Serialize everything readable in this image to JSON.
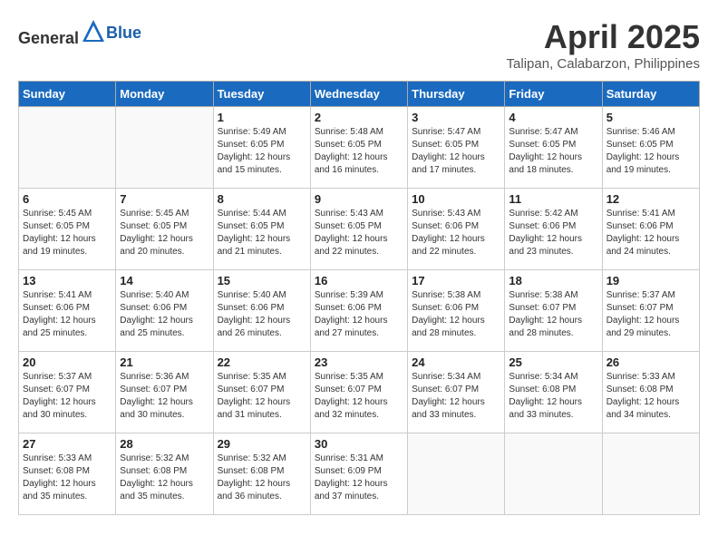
{
  "header": {
    "logo": {
      "text_general": "General",
      "text_blue": "Blue"
    },
    "title": "April 2025",
    "subtitle": "Talipan, Calabarzon, Philippines"
  },
  "calendar": {
    "days_of_week": [
      "Sunday",
      "Monday",
      "Tuesday",
      "Wednesday",
      "Thursday",
      "Friday",
      "Saturday"
    ],
    "weeks": [
      [
        {
          "day": "",
          "info": ""
        },
        {
          "day": "",
          "info": ""
        },
        {
          "day": "1",
          "info": "Sunrise: 5:49 AM\nSunset: 6:05 PM\nDaylight: 12 hours and 15 minutes."
        },
        {
          "day": "2",
          "info": "Sunrise: 5:48 AM\nSunset: 6:05 PM\nDaylight: 12 hours and 16 minutes."
        },
        {
          "day": "3",
          "info": "Sunrise: 5:47 AM\nSunset: 6:05 PM\nDaylight: 12 hours and 17 minutes."
        },
        {
          "day": "4",
          "info": "Sunrise: 5:47 AM\nSunset: 6:05 PM\nDaylight: 12 hours and 18 minutes."
        },
        {
          "day": "5",
          "info": "Sunrise: 5:46 AM\nSunset: 6:05 PM\nDaylight: 12 hours and 19 minutes."
        }
      ],
      [
        {
          "day": "6",
          "info": "Sunrise: 5:45 AM\nSunset: 6:05 PM\nDaylight: 12 hours and 19 minutes."
        },
        {
          "day": "7",
          "info": "Sunrise: 5:45 AM\nSunset: 6:05 PM\nDaylight: 12 hours and 20 minutes."
        },
        {
          "day": "8",
          "info": "Sunrise: 5:44 AM\nSunset: 6:05 PM\nDaylight: 12 hours and 21 minutes."
        },
        {
          "day": "9",
          "info": "Sunrise: 5:43 AM\nSunset: 6:05 PM\nDaylight: 12 hours and 22 minutes."
        },
        {
          "day": "10",
          "info": "Sunrise: 5:43 AM\nSunset: 6:06 PM\nDaylight: 12 hours and 22 minutes."
        },
        {
          "day": "11",
          "info": "Sunrise: 5:42 AM\nSunset: 6:06 PM\nDaylight: 12 hours and 23 minutes."
        },
        {
          "day": "12",
          "info": "Sunrise: 5:41 AM\nSunset: 6:06 PM\nDaylight: 12 hours and 24 minutes."
        }
      ],
      [
        {
          "day": "13",
          "info": "Sunrise: 5:41 AM\nSunset: 6:06 PM\nDaylight: 12 hours and 25 minutes."
        },
        {
          "day": "14",
          "info": "Sunrise: 5:40 AM\nSunset: 6:06 PM\nDaylight: 12 hours and 25 minutes."
        },
        {
          "day": "15",
          "info": "Sunrise: 5:40 AM\nSunset: 6:06 PM\nDaylight: 12 hours and 26 minutes."
        },
        {
          "day": "16",
          "info": "Sunrise: 5:39 AM\nSunset: 6:06 PM\nDaylight: 12 hours and 27 minutes."
        },
        {
          "day": "17",
          "info": "Sunrise: 5:38 AM\nSunset: 6:06 PM\nDaylight: 12 hours and 28 minutes."
        },
        {
          "day": "18",
          "info": "Sunrise: 5:38 AM\nSunset: 6:07 PM\nDaylight: 12 hours and 28 minutes."
        },
        {
          "day": "19",
          "info": "Sunrise: 5:37 AM\nSunset: 6:07 PM\nDaylight: 12 hours and 29 minutes."
        }
      ],
      [
        {
          "day": "20",
          "info": "Sunrise: 5:37 AM\nSunset: 6:07 PM\nDaylight: 12 hours and 30 minutes."
        },
        {
          "day": "21",
          "info": "Sunrise: 5:36 AM\nSunset: 6:07 PM\nDaylight: 12 hours and 30 minutes."
        },
        {
          "day": "22",
          "info": "Sunrise: 5:35 AM\nSunset: 6:07 PM\nDaylight: 12 hours and 31 minutes."
        },
        {
          "day": "23",
          "info": "Sunrise: 5:35 AM\nSunset: 6:07 PM\nDaylight: 12 hours and 32 minutes."
        },
        {
          "day": "24",
          "info": "Sunrise: 5:34 AM\nSunset: 6:07 PM\nDaylight: 12 hours and 33 minutes."
        },
        {
          "day": "25",
          "info": "Sunrise: 5:34 AM\nSunset: 6:08 PM\nDaylight: 12 hours and 33 minutes."
        },
        {
          "day": "26",
          "info": "Sunrise: 5:33 AM\nSunset: 6:08 PM\nDaylight: 12 hours and 34 minutes."
        }
      ],
      [
        {
          "day": "27",
          "info": "Sunrise: 5:33 AM\nSunset: 6:08 PM\nDaylight: 12 hours and 35 minutes."
        },
        {
          "day": "28",
          "info": "Sunrise: 5:32 AM\nSunset: 6:08 PM\nDaylight: 12 hours and 35 minutes."
        },
        {
          "day": "29",
          "info": "Sunrise: 5:32 AM\nSunset: 6:08 PM\nDaylight: 12 hours and 36 minutes."
        },
        {
          "day": "30",
          "info": "Sunrise: 5:31 AM\nSunset: 6:09 PM\nDaylight: 12 hours and 37 minutes."
        },
        {
          "day": "",
          "info": ""
        },
        {
          "day": "",
          "info": ""
        },
        {
          "day": "",
          "info": ""
        }
      ]
    ]
  }
}
